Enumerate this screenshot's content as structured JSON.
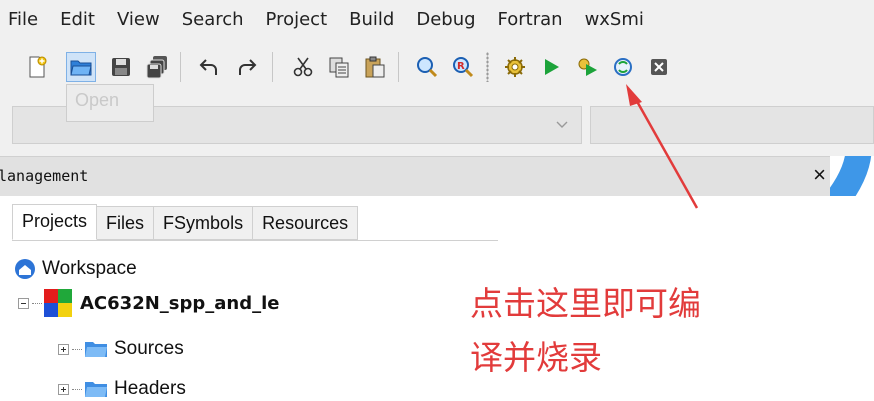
{
  "menubar": {
    "items": [
      "File",
      "Edit",
      "View",
      "Search",
      "Project",
      "Build",
      "Debug",
      "Fortran",
      "wxSmi"
    ]
  },
  "toolbar": {
    "icons": [
      "new-file-icon",
      "open-folder-icon",
      "save-icon",
      "save-all-icon",
      "undo-icon",
      "redo-icon",
      "cut-icon",
      "copy-icon",
      "paste-icon",
      "find-icon",
      "replace-icon",
      "build-icon",
      "run-icon",
      "build-and-run-icon",
      "rebuild-icon",
      "abort-icon"
    ],
    "tooltip": "Open"
  },
  "panel": {
    "title": "Management",
    "title_visible": "lanagement",
    "close": "×"
  },
  "tabs": [
    "Projects",
    "Files",
    "FSymbols",
    "Resources"
  ],
  "active_tab": "Projects",
  "tree": {
    "workspace": "Workspace",
    "project": "AC632N_spp_and_le",
    "folders": [
      "Sources",
      "Headers"
    ]
  },
  "annotation": {
    "line1": "点击这里即可编",
    "line2": "译并烧录",
    "color": "#e23b3b"
  },
  "colors": {
    "accent": "#3b8de0",
    "annotation_red": "#e23b3b",
    "run_green": "#1ca33a"
  }
}
